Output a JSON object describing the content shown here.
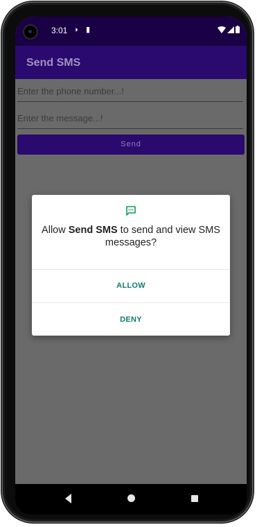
{
  "status_bar": {
    "time": "3:01",
    "icons": [
      "camera-punch-hole",
      "data-saver-icon",
      "sd-card-icon",
      "wifi-icon",
      "signal-icon",
      "battery-icon"
    ]
  },
  "app_bar": {
    "title": "Send SMS"
  },
  "form": {
    "phone_placeholder": "Enter the phone number...!",
    "phone_value": "",
    "message_placeholder": "Enter the message...!",
    "message_value": "",
    "send_label": "Send"
  },
  "dialog": {
    "icon": "sms-icon",
    "text_prefix": "Allow ",
    "app_name": "Send SMS",
    "text_suffix": " to send and view SMS messages?",
    "allow_label": "ALLOW",
    "deny_label": "DENY"
  },
  "nav_bar": {
    "icons": [
      "back-icon",
      "home-icon",
      "recents-icon"
    ]
  },
  "colors": {
    "primary": "#2a0a6e",
    "status_bar": "#1a0044",
    "scrim_background": "#6a6a6a",
    "dialog_button": "#0f7b6c",
    "dialog_icon": "#0f9d58"
  }
}
